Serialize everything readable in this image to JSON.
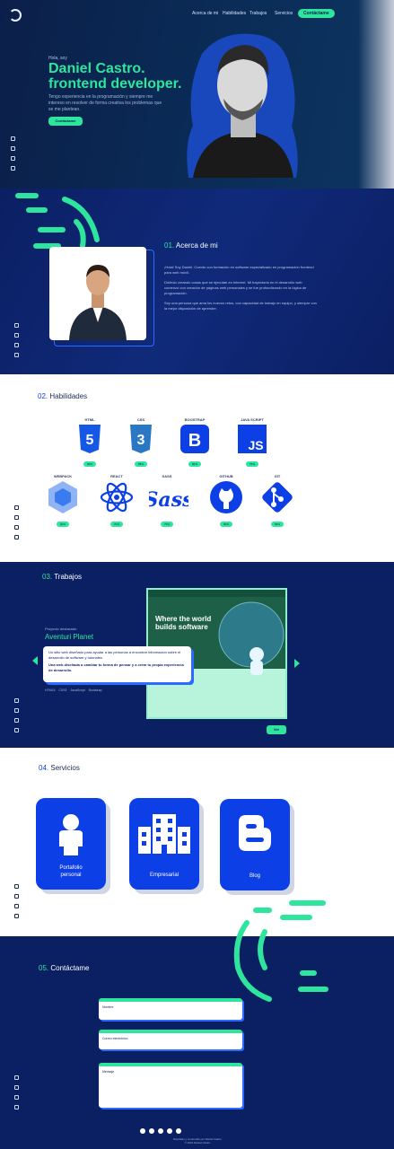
{
  "colors": {
    "navy": "#0b1f63",
    "accent": "#2ee59d",
    "blue": "#0d3fe6"
  },
  "nav": {
    "items": [
      "Acerca de mi",
      "Habilidades",
      "Trabajos",
      "Servicios"
    ],
    "cta": "Contáctame"
  },
  "hero": {
    "greeting": "Hola, soy",
    "name_line1": "Daniel Castro.",
    "name_line2": "frontend developer.",
    "description": "Tengo experiencia en la programación y siempre me intereso en resolver de forma creativa los problemas que se me plantean.",
    "button": "Contáctame"
  },
  "about": {
    "num": "01.",
    "title": "Acerca de mi",
    "paragraphs": [
      "¡Hola! Soy Daniel. Cuento con formación en software especializado en programación frontend para web móvil.",
      "Disfruto creando cosas que se ejecutan en Internet. Mi trayectoria en el desarrollo web comenzó con creación de páginas web personales y se fue profundizando en la lógica de programación.",
      "Soy una persona que ama los nuevos retos, con capacidad de trabajo en equipo, y siempre con la mejor disposición de aprender."
    ]
  },
  "skills": {
    "num": "02.",
    "title": "Habilidades",
    "items": [
      {
        "name": "HTML",
        "pct": "90%",
        "icon": "html5-icon"
      },
      {
        "name": "CSS",
        "pct": "85%",
        "icon": "css3-icon"
      },
      {
        "name": "BOOSTRAP",
        "pct": "80%",
        "icon": "bootstrap-icon"
      },
      {
        "name": "JAVA SCRIPT",
        "pct": "75%",
        "icon": "javascript-icon"
      },
      {
        "name": "WEBPACK",
        "pct": "60%",
        "icon": "webpack-icon"
      },
      {
        "name": "REACT",
        "pct": "70%",
        "icon": "react-icon"
      },
      {
        "name": "SASS",
        "pct": "75%",
        "icon": "sass-icon"
      },
      {
        "name": "GITHUB",
        "pct": "80%",
        "icon": "github-icon"
      },
      {
        "name": "GIT",
        "pct": "80%",
        "icon": "git-icon"
      }
    ]
  },
  "works": {
    "num": "03.",
    "title": "Trabajos",
    "kicker": "Proyecto destacado",
    "project_name": "Aventuri Planet",
    "desc_1": "Un sitio web diseñado para ayudar a las personas a encontrar información sobre el desarrollo de software y tutoriales.",
    "desc_2": "Una web diseñada a cambiar tu forma de pensar y a crear tu propia experiencia de desarrollo.",
    "tech_line": "HTML5    CSS3    JavaScript    Bootstrap",
    "preview_headline": "Where the world builds software",
    "button": "Ver"
  },
  "services": {
    "num": "04.",
    "title": "Servicios",
    "items": [
      {
        "name_1": "Portafolio",
        "name_2": "personal",
        "icon": "person-icon"
      },
      {
        "name_1": "Empresarial",
        "name_2": "",
        "icon": "building-icon"
      },
      {
        "name_1": "Blog",
        "name_2": "",
        "icon": "blogger-icon"
      }
    ]
  },
  "contact": {
    "num": "05.",
    "title": "Contáctame",
    "fields": [
      "Nombre",
      "Correo electrónico",
      "Mensaje"
    ],
    "footer_line1": "Diseñado y construido por Daniel Castro",
    "footer_line2": "© 2021 Daniel Castro"
  }
}
